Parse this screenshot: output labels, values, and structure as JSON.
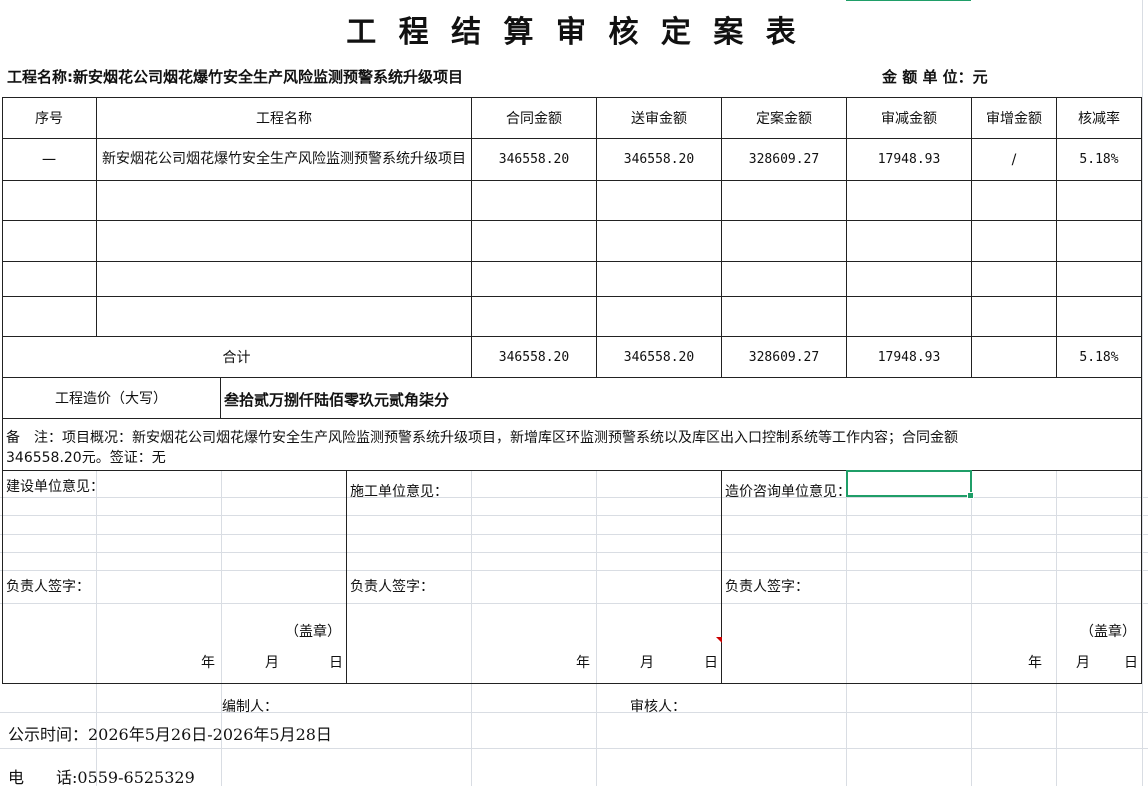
{
  "title": "工 程 结 算 审 核 定 案 表",
  "project_line": {
    "label": "工程名称:新安烟花公司烟花爆竹安全生产风险监测预警系统升级项目",
    "unit": "金 额 单 位：元"
  },
  "table": {
    "headers": [
      "序号",
      "工程名称",
      "合同金额",
      "送审金额",
      "定案金额",
      "审减金额",
      "审增金额",
      "核减率"
    ],
    "rows": [
      [
        "一",
        "新安烟花公司烟花爆竹安全生产风险监测预警系统升级项目",
        "346558.20",
        "346558.20",
        "328609.27",
        "17948.93",
        "/",
        "5.18%"
      ]
    ],
    "total": {
      "label": "合计",
      "values": [
        "346558.20",
        "346558.20",
        "328609.27",
        "17948.93",
        "",
        "5.18%"
      ]
    }
  },
  "price_capital": {
    "label": "工程造价（大写）",
    "value": "叁拾贰万捌仟陆佰零玖元贰角柒分"
  },
  "remarks": {
    "line1": "备　注：项目概况：新安烟花公司烟花爆竹安全生产风险监测预警系统升级项目，新增库区环监测预警系统以及库区出入口控制系统等工作内容；合同金额",
    "line2": "346558.20元。签证：无"
  },
  "opinions": {
    "construction_unit": "建设单位意见：",
    "builder_unit": "施工单位意见：",
    "consulting_unit": "造价咨询单位意见：",
    "signature_label": "负责人签字：",
    "seal_label": "（盖章）",
    "year": "年",
    "month": "月",
    "day": "日"
  },
  "footer": {
    "preparer": "编制人：",
    "reviewer": "审核人：",
    "publicity": "公示时间：2026年5月26日-2026年5月28日",
    "phone": "电　　话:0559-6525329"
  },
  "colors": {
    "selection": "#1f9e68",
    "grid": "#d9dde3",
    "border": "#222222",
    "comment_marker": "#cc0000"
  }
}
